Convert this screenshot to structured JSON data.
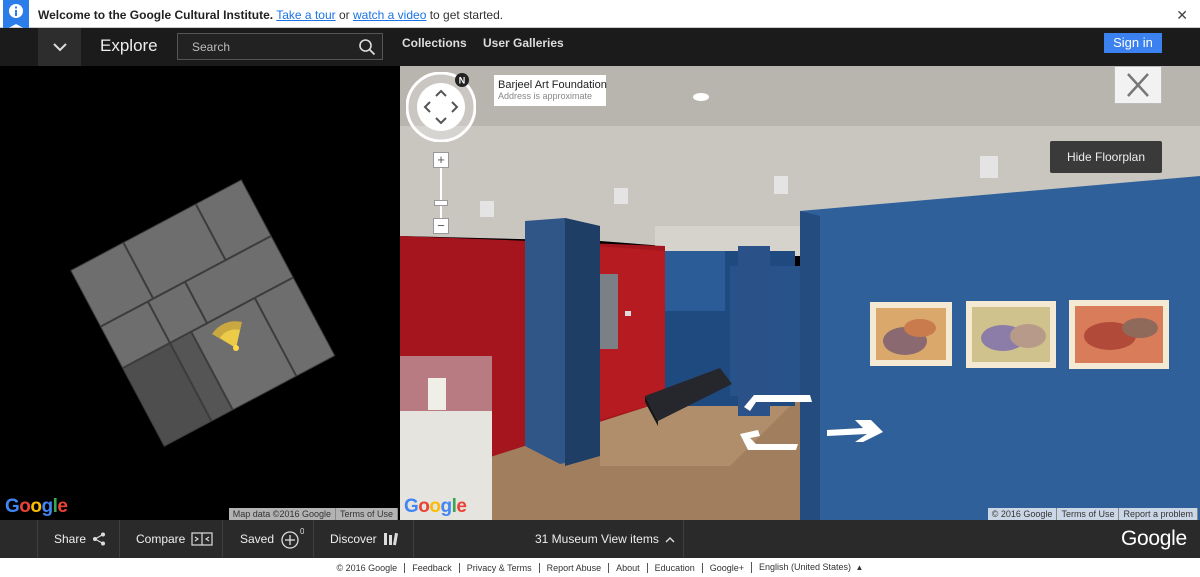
{
  "welcome": {
    "title": "Welcome to the Google Cultural Institute.",
    "tour_link": "Take a tour",
    "or": "or",
    "video_link": "watch a video",
    "suffix": "to get started.",
    "close": "✕"
  },
  "nav": {
    "explore": "Explore",
    "search_placeholder": "Search",
    "collections": "Collections",
    "user_galleries": "User Galleries",
    "sign_in": "Sign in"
  },
  "map": {
    "logo": "Google",
    "attribution": [
      "Map data ©2016 Google",
      "Terms of Use"
    ]
  },
  "streetview": {
    "compass_letter": "N",
    "zoom_in": "+",
    "zoom_out": "−",
    "place_name": "Barjeel Art Foundation",
    "place_note": "Address is approximate",
    "hide_floorplan": "Hide Floorplan",
    "logo": "Google",
    "attribution": [
      "© 2016 Google",
      "Terms of Use",
      "Report a problem"
    ]
  },
  "toolbar": {
    "share": "Share",
    "compare": "Compare",
    "saved": "Saved",
    "saved_count": "0",
    "discover": "Discover",
    "museum_items": "31 Museum View items",
    "logo": "Google"
  },
  "footer": {
    "items": [
      "© 2016 Google",
      "Feedback",
      "Privacy & Terms",
      "Report Abuse",
      "About",
      "Education",
      "Google+",
      "English (United States)"
    ]
  },
  "colors": {
    "signin": "#3b82f0",
    "wall_blue": "#2f5a8e",
    "wall_red": "#a3141c",
    "floor": "#9c7b5c"
  }
}
